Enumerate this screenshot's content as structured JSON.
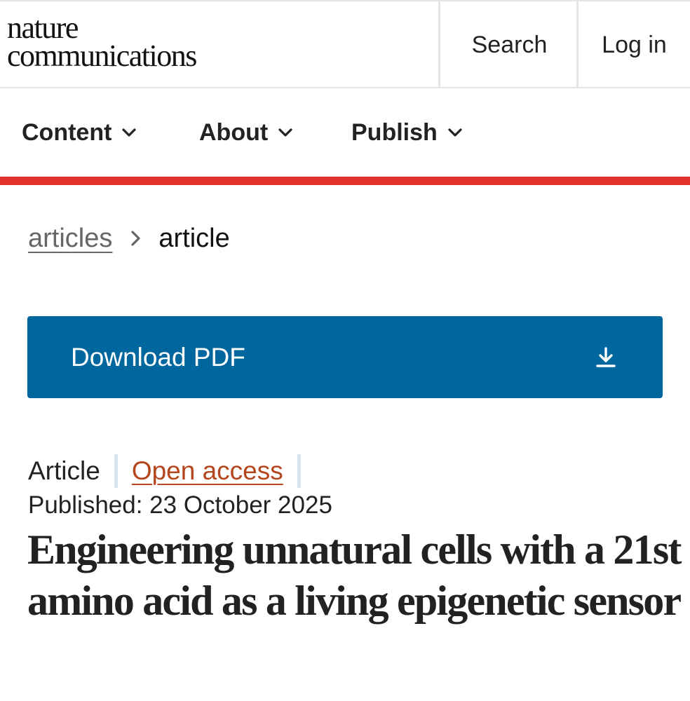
{
  "header": {
    "logo_line1": "nature",
    "logo_line2": "communications",
    "search_label": "Search",
    "login_label": "Log in"
  },
  "nav": {
    "items": [
      {
        "label": "Content",
        "icon": "chevron-down-icon"
      },
      {
        "label": "About",
        "icon": "chevron-down-icon"
      },
      {
        "label": "Publish",
        "icon": "chevron-down-icon"
      }
    ],
    "accent_color": "#e0322b"
  },
  "breadcrumb": {
    "parent": "articles",
    "separator_icon": "chevron-right-icon",
    "current": "article"
  },
  "download": {
    "label": "Download PDF",
    "icon": "download-icon",
    "color": "#00679e"
  },
  "article": {
    "type": "Article",
    "access": "Open access",
    "access_color": "#b4461d",
    "published": "Published: 23 October 2025",
    "title": "Engineering unnatural cells with a 21st amino acid as a living epigenetic sensor"
  }
}
